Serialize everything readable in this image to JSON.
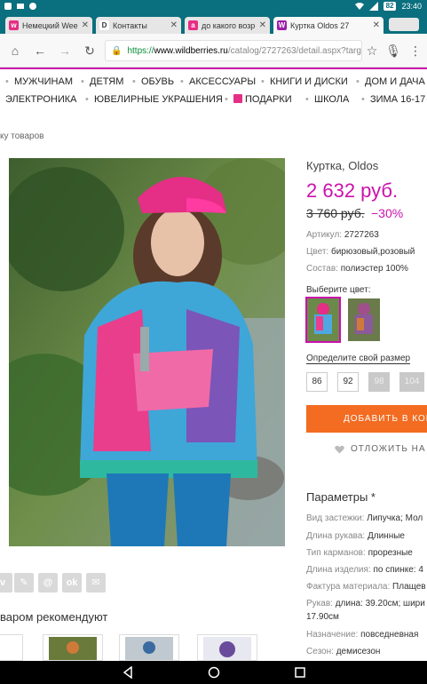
{
  "status": {
    "time": "23:40",
    "battery": "82"
  },
  "tabs": [
    {
      "title": "Немецкий Week",
      "fav": "w",
      "color": "#e52e86",
      "active": false
    },
    {
      "title": "Контакты",
      "fav": "D",
      "color": "#444444",
      "active": false
    },
    {
      "title": "до какого возр",
      "fav": "a",
      "color": "#e52e86",
      "active": false
    },
    {
      "title": "Куртка Oldos 27",
      "fav": "W",
      "color": "#9b1fa8",
      "active": true
    }
  ],
  "address": {
    "https": "https://",
    "host": "www.wildberries.ru",
    "path": "/catalog/2727263/detail.aspx?targ"
  },
  "menu_row1": [
    "МУЖЧИНАМ",
    "ДЕТЯМ",
    "ОБУВЬ",
    "АКСЕССУАРЫ",
    "КНИГИ И ДИСКИ",
    "ДОМ И ДАЧА"
  ],
  "menu_row2": [
    "ЭЛЕКТРОНИКА",
    "ЮВЕЛИРНЫЕ УКРАШЕНИЯ",
    "ПОДАРКИ",
    "ШКОЛА",
    "ЗИМА 16-17"
  ],
  "breadcrumb": "ку товаров",
  "product": {
    "title": "Куртка, Oldos",
    "price": "2 632 руб.",
    "old_price": "3 760 руб.",
    "discount": "−30%",
    "article_label": "Артикул:",
    "article": "2727263",
    "color_label": "Цвет:",
    "color": "бирюзовый,розовый",
    "composition_label": "Состав:",
    "composition": "полиэстер 100%",
    "choose_color": "Выберите цвет:",
    "choose_size": "Определите свой размер",
    "sizes": [
      {
        "label": "86",
        "available": true
      },
      {
        "label": "92",
        "available": true
      },
      {
        "label": "98",
        "available": false
      },
      {
        "label": "104",
        "available": false
      }
    ],
    "add_to_cart": "ДОБАВИТЬ В КОР",
    "postpone": "ОТЛОЖИТЬ НА"
  },
  "params": {
    "heading": "Параметры *",
    "items": [
      {
        "label": "Вид застежки:",
        "value": "Липучка; Мол"
      },
      {
        "label": "Длина рукава:",
        "value": "Длинные"
      },
      {
        "label": "Тип карманов:",
        "value": "прорезные"
      },
      {
        "label": "Длина изделия:",
        "value": "по спинке: 4"
      },
      {
        "label": "Фактура материала:",
        "value": "Плащев"
      },
      {
        "label": "Рукав:",
        "value": "длина: 39.20см; шири"
      },
      {
        "label": "",
        "value": "17.90см"
      },
      {
        "label": "Назначение:",
        "value": "повседневная"
      },
      {
        "label": "Сезон:",
        "value": "демисезон"
      }
    ]
  },
  "share_icons": [
    "vk",
    "edit",
    "mail-ru",
    "odnoklassniki",
    "email"
  ],
  "recommend_heading": "варом рекомендуют",
  "colors": {
    "accent": "#cb11ab",
    "orange": "#f36c21",
    "statusbar": "#0a6f7e"
  }
}
